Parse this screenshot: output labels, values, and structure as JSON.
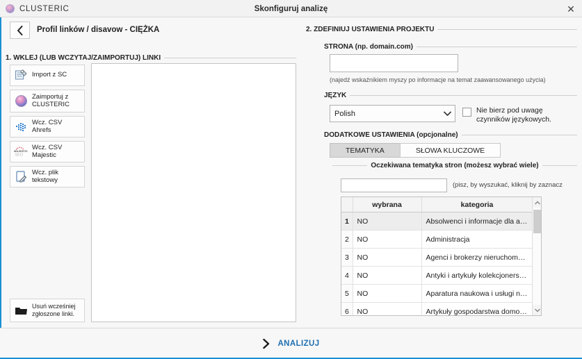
{
  "titlebar": {
    "brand": "CLUSTERIC",
    "brand_logo_icon": "clusteric-circle-icon",
    "title": "Skonfiguruj analizę",
    "close_icon": "close-icon"
  },
  "header": {
    "back_icon": "chevron-left-icon",
    "page_title": "Profil linków / disavow - CIĘŻKA"
  },
  "left_panel": {
    "legend": "1. WKLEJ (LUB WCZYTAJ/ZAIMPORTUJ) LINKI",
    "buttons": [
      {
        "label": "Import z SC",
        "icon": "import-sc-icon"
      },
      {
        "label": "Zaimportuj z\nCLUSTERIC",
        "icon": "clusteric-sphere-icon"
      },
      {
        "label": "Wcz. CSV Ahrefs",
        "icon": "ahrefs-icon"
      },
      {
        "label": "Wcz. CSV Majestic",
        "icon": "majestic-seo-icon"
      },
      {
        "label": "Wcz. plik tekstowy",
        "icon": "text-file-icon"
      }
    ],
    "delete_button": {
      "label": "Usuń wcześniej\nzgłoszone linki.",
      "icon": "folder-icon"
    },
    "links_textarea_value": "",
    "links_textarea_placeholder": ""
  },
  "right_panel": {
    "legend": "2. ZDEFINIUJ USTAWIENIA PROJEKTU",
    "strona": {
      "legend": "STRONA (np. domain.com)",
      "value": "",
      "placeholder": "",
      "hint": "(najedź wskaźnikiem myszy po informacje na temat zaawansowanego użycia)"
    },
    "jezyk": {
      "legend": "JĘZYK",
      "selected": "Polish",
      "caret_icon": "chevron-down-icon",
      "checkbox_label": "Nie bierz pod uwagę\nczynników językowych.",
      "checkbox_checked": false
    },
    "dodatkowe": {
      "legend": "DODATKOWE USTAWIENIA (opcjonalne)",
      "tabs": [
        {
          "label": "TEMATYKA",
          "active": true
        },
        {
          "label": "SŁOWA KLUCZOWE",
          "active": false
        }
      ],
      "subsection_legend": "Oczekiwana tematyka stron (możesz wybrać wiele)",
      "search_value": "",
      "search_placeholder": "",
      "search_hint": "(pisz, by wyszukać, kliknij by zaznacz",
      "table": {
        "columns": [
          "",
          "wybrana",
          "kategoria"
        ],
        "rows": [
          {
            "num": "1",
            "wybrana": "NO",
            "kategoria": "Absolwenci i informacje dla absol...",
            "selected": true
          },
          {
            "num": "2",
            "wybrana": "NO",
            "kategoria": "Administracja",
            "selected": false
          },
          {
            "num": "3",
            "wybrana": "NO",
            "kategoria": "Agenci i brokerzy nieruchomości",
            "selected": false
          },
          {
            "num": "4",
            "wybrana": "NO",
            "kategoria": "Antyki i artykuły kolekcjonerskie",
            "selected": false
          },
          {
            "num": "5",
            "wybrana": "NO",
            "kategoria": "Aparatura naukowa i usługi nauko...",
            "selected": false
          },
          {
            "num": "6",
            "wybrana": "NO",
            "kategoria": "Artykuły gospodarstwa domowego",
            "selected": false
          }
        ],
        "scroll_up_icon": "chevron-up-icon",
        "scroll_down_icon": "chevron-down-icon"
      }
    }
  },
  "footer": {
    "analyze_label": "ANALIZUJ",
    "analyze_icon": "chevron-right-icon"
  },
  "colors": {
    "accent_blue": "#1a8fd4",
    "analyze_text": "#1f6fb0",
    "window_bg": "#f7f7f7"
  }
}
